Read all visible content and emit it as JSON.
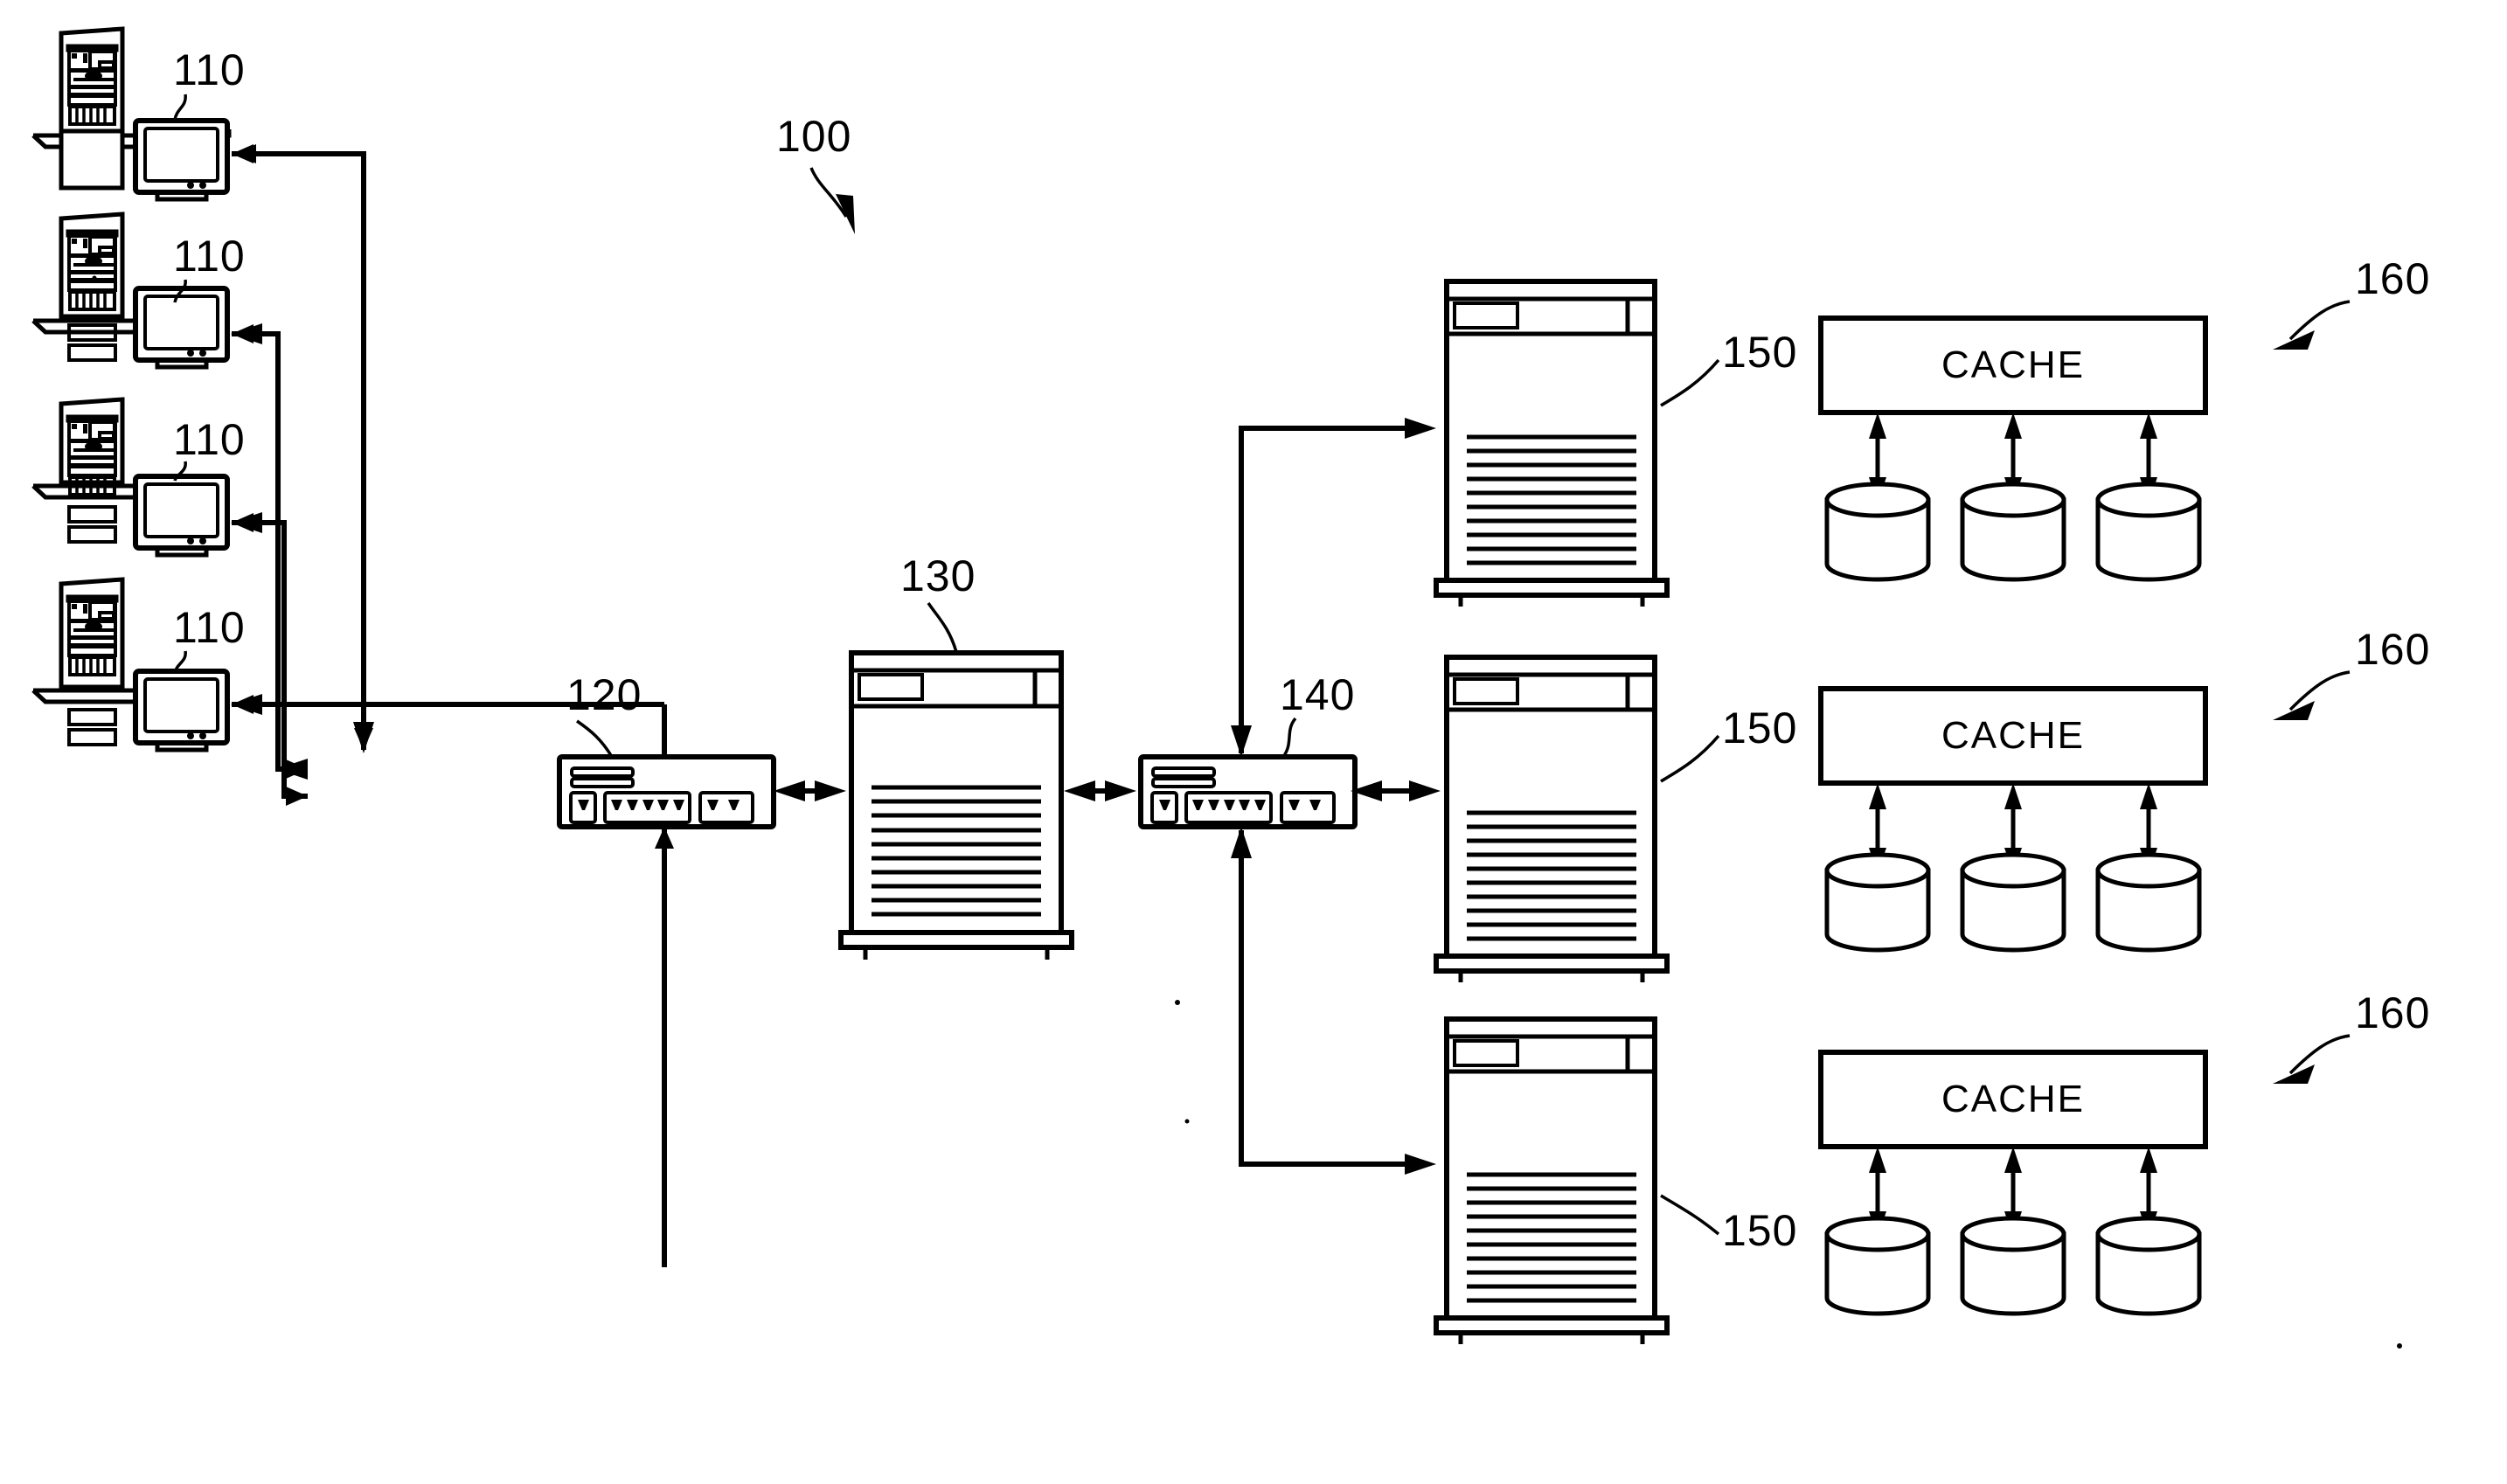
{
  "figure": {
    "type": "patent-network-diagram",
    "system_reference": "100",
    "background_color": "#ffffff",
    "line_color": "#000000"
  },
  "labels": {
    "system": "100",
    "client": "110",
    "client_switch": "120",
    "application_server": "130",
    "backend_switch": "140",
    "database_server": "150",
    "cache_group": "160",
    "cache_box": "CACHE"
  },
  "clients": [
    {
      "ref": "110",
      "name": "client-workstation-1"
    },
    {
      "ref": "110",
      "name": "client-workstation-2"
    },
    {
      "ref": "110",
      "name": "client-workstation-3"
    },
    {
      "ref": "110",
      "name": "client-workstation-4"
    }
  ],
  "switches": [
    {
      "ref": "120",
      "name": "client-side-switch",
      "port_groups": [
        1,
        5,
        2
      ]
    },
    {
      "ref": "140",
      "name": "server-side-switch",
      "port_groups": [
        1,
        5,
        2
      ]
    }
  ],
  "servers": {
    "middle": {
      "ref": "130",
      "name": "application-server"
    },
    "backend": [
      {
        "ref": "150",
        "name": "database-server-1"
      },
      {
        "ref": "150",
        "name": "database-server-2"
      },
      {
        "ref": "150",
        "name": "database-server-3"
      }
    ]
  },
  "cache_groups": [
    {
      "ref": "160",
      "label": "CACHE",
      "disk_count": 3
    },
    {
      "ref": "160",
      "label": "CACHE",
      "disk_count": 3
    },
    {
      "ref": "160",
      "label": "CACHE",
      "disk_count": 3
    }
  ]
}
